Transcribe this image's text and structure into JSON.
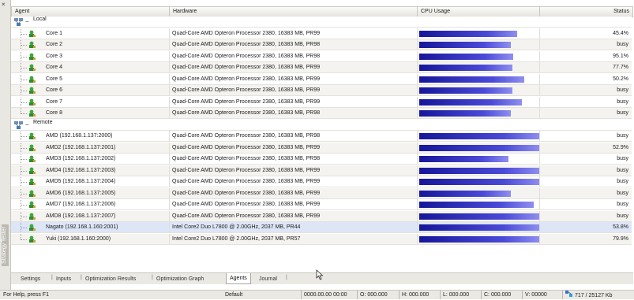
{
  "panel": {
    "close_glyph": "×",
    "vertical_title": "Strategy Tester"
  },
  "columns": {
    "agent": "Agent",
    "hardware": "Hardware",
    "cpu": "CPU Usage",
    "status": "Status"
  },
  "groups": [
    {
      "name": "Local",
      "icon": "agents-group-icon",
      "rows": [
        {
          "agent": "Core 1",
          "hardware": "Quad-Core AMD Opteron Processor 2380, 16383 MB, PR99",
          "cpu_fraction": 0.81,
          "status": "45.4%"
        },
        {
          "agent": "Core 2",
          "hardware": "Quad-Core AMD Opteron Processor 2380, 16383 MB, PR98",
          "cpu_fraction": 0.76,
          "status": "busy"
        },
        {
          "agent": "Core 3",
          "hardware": "Quad-Core AMD Opteron Processor 2380, 16383 MB, PR98",
          "cpu_fraction": 0.78,
          "status": "95.1%"
        },
        {
          "agent": "Core 4",
          "hardware": "Quad-Core AMD Opteron Processor 2380, 16383 MB, PR99",
          "cpu_fraction": 0.77,
          "status": "77.7%"
        },
        {
          "agent": "Core 5",
          "hardware": "Quad-Core AMD Opteron Processor 2380, 16383 MB, PR99",
          "cpu_fraction": 0.87,
          "status": "50.2%"
        },
        {
          "agent": "Core 6",
          "hardware": "Quad-Core AMD Opteron Processor 2380, 16383 MB, PR99",
          "cpu_fraction": 0.77,
          "status": "busy"
        },
        {
          "agent": "Core 7",
          "hardware": "Quad-Core AMD Opteron Processor 2380, 16383 MB, PR99",
          "cpu_fraction": 0.85,
          "status": "busy"
        },
        {
          "agent": "Core 8",
          "hardware": "Quad-Core AMD Opteron Processor 2380, 16383 MB, PR98",
          "cpu_fraction": 0.76,
          "status": "busy"
        }
      ]
    },
    {
      "name": "Remote",
      "icon": "agents-group-icon",
      "rows": [
        {
          "agent": "AMD (192.168.1.137:2000)",
          "hardware": "Quad-Core AMD Opteron Processor 2380, 16383 MB, PR98",
          "cpu_fraction": 1.0,
          "status": "busy"
        },
        {
          "agent": "AMD2 (192.168.1.137:2001)",
          "hardware": "Quad-Core AMD Opteron Processor 2380, 16383 MB, PR99",
          "cpu_fraction": 1.0,
          "status": "52.9%"
        },
        {
          "agent": "AMD3 (192.168.1.137:2002)",
          "hardware": "Quad-Core AMD Opteron Processor 2380, 16383 MB, PR98",
          "cpu_fraction": 0.74,
          "status": "busy"
        },
        {
          "agent": "AMD4 (192.168.1.137:2003)",
          "hardware": "Quad-Core AMD Opteron Processor 2380, 16383 MB, PR99",
          "cpu_fraction": 1.0,
          "status": "busy"
        },
        {
          "agent": "AMD5 (192.168.1.137:2004)",
          "hardware": "Quad-Core AMD Opteron Processor 2380, 16383 MB, PR99",
          "cpu_fraction": 1.0,
          "status": "busy"
        },
        {
          "agent": "AMD6 (192.168.1.137:2005)",
          "hardware": "Quad-Core AMD Opteron Processor 2380, 16383 MB, PR99",
          "cpu_fraction": 0.76,
          "status": "busy"
        },
        {
          "agent": "AMD7 (192.168.1.137:2006)",
          "hardware": "Quad-Core AMD Opteron Processor 2380, 16383 MB, PR99",
          "cpu_fraction": 0.95,
          "status": "busy"
        },
        {
          "agent": "AMD8 (192.168.1.137:2007)",
          "hardware": "Quad-Core AMD Opteron Processor 2380, 16383 MB, PR99",
          "cpu_fraction": 1.0,
          "status": "busy"
        },
        {
          "agent": "Nagato (192.168.1.160:2001)",
          "hardware": "Intel Core2 Duo  L7800 @ 2.00GHz, 2037 MB, PR44",
          "cpu_fraction": 1.0,
          "status": "53.8%",
          "selected": true
        },
        {
          "agent": "Yuki (192.168.1.160:2000)",
          "hardware": "Intel Core2 Duo  L7800 @ 2.00GHz, 2037 MB, PR57",
          "cpu_fraction": 1.0,
          "status": "79.9%"
        }
      ]
    }
  ],
  "tabs": [
    {
      "label": "Settings",
      "active": false
    },
    {
      "label": "Inputs",
      "active": false
    },
    {
      "label": "Optimization Results",
      "active": false
    },
    {
      "label": "Optimization Graph",
      "active": false
    },
    {
      "label": "Agents",
      "active": true
    },
    {
      "label": "Journal",
      "active": false
    }
  ],
  "statusbar": {
    "help": "For Help, press F1",
    "profile": "Default",
    "datetime": "0000.00.00 00:00",
    "open": "O: 000.000",
    "high": "H: 000.000",
    "low": "L: 000.000",
    "close": "C: 000.000",
    "volume": "V: 00000",
    "traffic": "717 / 25127 Kb"
  },
  "colors": {
    "bar_dark": "#16169a",
    "bar_light": "#8f8ff0",
    "selected_row": "#dde6f7",
    "alt_row": "#f4f3ef"
  }
}
